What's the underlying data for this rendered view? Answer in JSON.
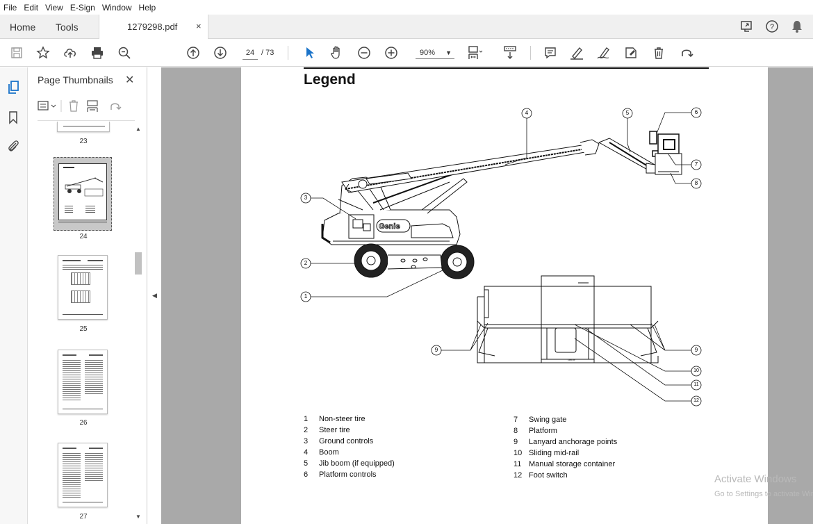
{
  "menu": [
    "File",
    "Edit",
    "View",
    "E-Sign",
    "Window",
    "Help"
  ],
  "tabs": {
    "home": "Home",
    "tools": "Tools",
    "document": "1279298.pdf",
    "close": "×"
  },
  "toolbar": {
    "page_current": "24",
    "page_total": "/ 73",
    "zoom": "90%"
  },
  "thumbnails": {
    "title": "Page Thumbnails",
    "close": "✕",
    "pages": [
      "23",
      "24",
      "25",
      "26",
      "27"
    ]
  },
  "document": {
    "heading": "Legend",
    "brand_on_machine": "Genie",
    "callouts": [
      "1",
      "2",
      "3",
      "4",
      "5",
      "6",
      "7",
      "8",
      "9",
      "9",
      "10",
      "11",
      "12"
    ],
    "legend_left": [
      {
        "num": "1",
        "label": "Non-steer tire"
      },
      {
        "num": "2",
        "label": "Steer tire"
      },
      {
        "num": "3",
        "label": "Ground controls"
      },
      {
        "num": "4",
        "label": "Boom"
      },
      {
        "num": "5",
        "label": "Jib boom (if equipped)"
      },
      {
        "num": "6",
        "label": "Platform controls"
      }
    ],
    "legend_right": [
      {
        "num": "7",
        "label": "Swing gate"
      },
      {
        "num": "8",
        "label": "Platform"
      },
      {
        "num": "9",
        "label": "Lanyard anchorage points"
      },
      {
        "num": "10",
        "label": "Sliding mid-rail"
      },
      {
        "num": "11",
        "label": "Manual storage container"
      },
      {
        "num": "12",
        "label": "Foot switch"
      }
    ]
  },
  "watermark": {
    "line1": "Activate Windows",
    "line2": "Go to Settings to activate Windows."
  }
}
